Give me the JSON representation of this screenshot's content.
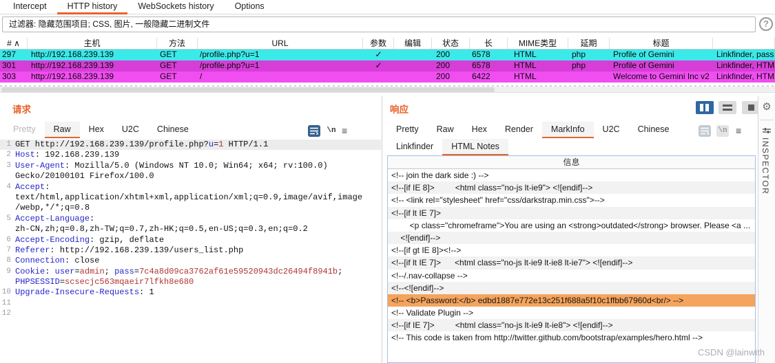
{
  "main_tabs": {
    "items": [
      {
        "label": "Intercept",
        "active": false
      },
      {
        "label": "HTTP history",
        "active": true
      },
      {
        "label": "WebSockets history",
        "active": false
      },
      {
        "label": "Options",
        "active": false
      }
    ]
  },
  "filter": {
    "text": "过滤器: 隐藏范围项目; CSS, 图片, 一般隐藏二进制文件",
    "help": "?"
  },
  "history_table": {
    "columns": [
      "# ∧",
      "主机",
      "方法",
      "URL",
      "参数",
      "编辑",
      "状态",
      "长",
      "MIME类型",
      "延期",
      "标题",
      ""
    ],
    "rows": [
      {
        "id": "297",
        "host": "http://192.168.239.139",
        "method": "GET",
        "url": "/profile.php?u=1",
        "params": "✓",
        "edited": "",
        "status": "200",
        "length": "6578",
        "mime": "HTML",
        "ext": "php",
        "title": "Profile of Gemini",
        "comment": "Linkfinder, pass",
        "color": "row-cyan"
      },
      {
        "id": "301",
        "host": "http://192.168.239.139",
        "method": "GET",
        "url": "/profile.php?u=1",
        "params": "✓",
        "edited": "",
        "status": "200",
        "length": "6578",
        "mime": "HTML",
        "ext": "php",
        "title": "Profile of Gemini",
        "comment": "Linkfinder, HTM",
        "color": "row-mag-sel"
      },
      {
        "id": "303",
        "host": "http://192.168.239.139",
        "method": "GET",
        "url": "/",
        "params": "",
        "edited": "",
        "status": "200",
        "length": "6422",
        "mime": "HTML",
        "ext": "",
        "title": "Welcome to Gemini Inc v2",
        "comment": "Linkfinder, HTM",
        "color": "row-mag"
      }
    ]
  },
  "request": {
    "title": "请求",
    "tabs": [
      {
        "label": "Pretty",
        "disabled": true
      },
      {
        "label": "Raw",
        "active": true
      },
      {
        "label": "Hex"
      },
      {
        "label": "U2C"
      },
      {
        "label": "Chinese"
      }
    ],
    "icons": {
      "wrap": "wrap-lines-icon",
      "newline": "\\n",
      "menu": "≡"
    },
    "lines": [
      {
        "n": "1",
        "hl": true,
        "seg": [
          {
            "t": "GET http://192.168.239.139/profile.php?",
            "c": "k"
          },
          {
            "t": "u",
            "c": "b"
          },
          {
            "t": "=",
            "c": "k"
          },
          {
            "t": "1",
            "c": "r"
          },
          {
            "t": " HTTP/1.1",
            "c": "k"
          }
        ]
      },
      {
        "n": "2",
        "seg": [
          {
            "t": "Host",
            "c": "b"
          },
          {
            "t": ": 192.168.239.139",
            "c": "k"
          }
        ]
      },
      {
        "n": "3",
        "seg": [
          {
            "t": "User-Agent",
            "c": "b"
          },
          {
            "t": ": Mozilla/5.0 (Windows NT 10.0; Win64; x64; rv:100.0)",
            "c": "k"
          }
        ]
      },
      {
        "n": "",
        "seg": [
          {
            "t": "Gecko/20100101 Firefox/100.0",
            "c": "k"
          }
        ]
      },
      {
        "n": "4",
        "seg": [
          {
            "t": "Accept",
            "c": "b"
          },
          {
            "t": ":",
            "c": "k"
          }
        ]
      },
      {
        "n": "",
        "seg": [
          {
            "t": "text/html,application/xhtml+xml,application/xml;q=0.9,image/avif,image",
            "c": "k"
          }
        ]
      },
      {
        "n": "",
        "seg": [
          {
            "t": "/webp,*/*;q=0.8",
            "c": "k"
          }
        ]
      },
      {
        "n": "5",
        "seg": [
          {
            "t": "Accept-Language",
            "c": "b"
          },
          {
            "t": ":",
            "c": "k"
          }
        ]
      },
      {
        "n": "",
        "seg": [
          {
            "t": "zh-CN,zh;q=0.8,zh-TW;q=0.7,zh-HK;q=0.5,en-US;q=0.3,en;q=0.2",
            "c": "k"
          }
        ]
      },
      {
        "n": "6",
        "seg": [
          {
            "t": "Accept-Encoding",
            "c": "b"
          },
          {
            "t": ": gzip, deflate",
            "c": "k"
          }
        ]
      },
      {
        "n": "7",
        "seg": [
          {
            "t": "Referer",
            "c": "b"
          },
          {
            "t": ": http://192.168.239.139/users_list.php",
            "c": "k"
          }
        ]
      },
      {
        "n": "8",
        "seg": [
          {
            "t": "Connection",
            "c": "b"
          },
          {
            "t": ": close",
            "c": "k"
          }
        ]
      },
      {
        "n": "9",
        "seg": [
          {
            "t": "Cookie",
            "c": "b"
          },
          {
            "t": ": ",
            "c": "k"
          },
          {
            "t": "user",
            "c": "b"
          },
          {
            "t": "=",
            "c": "k"
          },
          {
            "t": "admin",
            "c": "r"
          },
          {
            "t": "; ",
            "c": "k"
          },
          {
            "t": "pass",
            "c": "b"
          },
          {
            "t": "=",
            "c": "k"
          },
          {
            "t": "7c4a8d09ca3762af61e59520943dc26494f8941b",
            "c": "r"
          },
          {
            "t": ";",
            "c": "k"
          }
        ]
      },
      {
        "n": "",
        "seg": [
          {
            "t": "PHPSESSID",
            "c": "b"
          },
          {
            "t": "=",
            "c": "k"
          },
          {
            "t": "scsecjc563mqaeir7lfkh8e680",
            "c": "r"
          }
        ]
      },
      {
        "n": "10",
        "seg": [
          {
            "t": "Upgrade-Insecure-Requests",
            "c": "b"
          },
          {
            "t": ": 1",
            "c": "k"
          }
        ]
      },
      {
        "n": "11",
        "seg": []
      },
      {
        "n": "12",
        "seg": []
      }
    ]
  },
  "response": {
    "title": "响应",
    "tabs": [
      {
        "label": "Pretty"
      },
      {
        "label": "Raw"
      },
      {
        "label": "Hex"
      },
      {
        "label": "Render"
      },
      {
        "label": "MarkInfo",
        "active": true
      },
      {
        "label": "U2C"
      },
      {
        "label": "Chinese"
      }
    ],
    "subtabs": [
      {
        "label": "Linkfinder"
      },
      {
        "label": "HTML Notes",
        "active": true
      }
    ],
    "icons": {
      "newline": "\\n",
      "menu": "≡"
    },
    "table": {
      "header": "信息",
      "rows": [
        {
          "text": "<!-- join the dark side :) -->",
          "bg": "white"
        },
        {
          "text": "<!--[if IE 8]>         <html class=\"no-js lt-ie9\"> <![endif]-->",
          "bg": "gray"
        },
        {
          "text": "<!-- <link rel=\"stylesheet\" href=\"css/darkstrap.min.css\">-->",
          "bg": "white"
        },
        {
          "text": "<!--[if lt IE 7]>",
          "bg": "gray"
        },
        {
          "text": "        <p class=\"chromeframe\">You are using an <strong>outdated</strong> browser. Please <a ...",
          "bg": "white"
        },
        {
          "text": "    <![endif]-->",
          "bg": "gray"
        },
        {
          "text": "<!--[if gt IE 8]><!-->",
          "bg": "white"
        },
        {
          "text": "<!--[if lt IE 7]>      <html class=\"no-js lt-ie9 lt-ie8 lt-ie7\"> <![endif]-->",
          "bg": "gray"
        },
        {
          "text": "<!--/.nav-collapse -->",
          "bg": "white"
        },
        {
          "text": "<!--<![endif]-->",
          "bg": "gray"
        },
        {
          "text": "<!-- <b>Password:</b> edbd1887e772e13c251f688a5f10c1ffbb67960d<br/> -->",
          "bg": "orange"
        },
        {
          "text": "<!-- Validate Plugin -->",
          "bg": "white"
        },
        {
          "text": "<!--[if IE 7]>         <html class=\"no-js lt-ie9 lt-ie8\"> <![endif]-->",
          "bg": "gray"
        },
        {
          "text": "<!-- This code is taken from http://twitter.github.com/bootstrap/examples/hero.html -->",
          "bg": "white"
        }
      ]
    }
  },
  "inspector": {
    "label": "INSPECTOR"
  },
  "watermark": "CSDN @lainwith"
}
